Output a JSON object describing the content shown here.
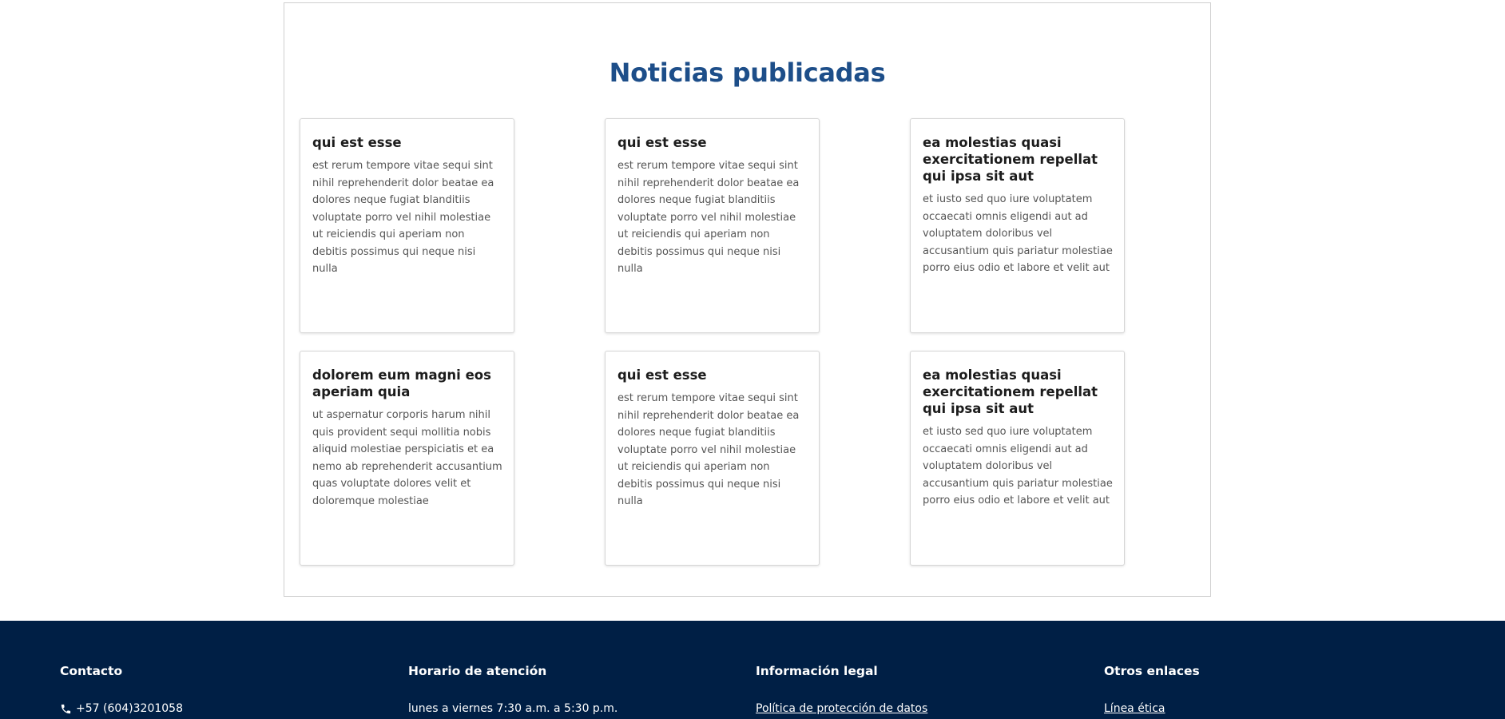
{
  "news": {
    "title": "Noticias publicadas",
    "cards": [
      {
        "title": "qui est esse",
        "body": "est rerum tempore vitae sequi sint nihil reprehenderit dolor beatae ea dolores neque fugiat blanditiis voluptate porro vel nihil molestiae ut reiciendis qui aperiam non debitis possimus qui neque nisi nulla"
      },
      {
        "title": "qui est esse",
        "body": "est rerum tempore vitae sequi sint nihil reprehenderit dolor beatae ea dolores neque fugiat blanditiis voluptate porro vel nihil molestiae ut reiciendis qui aperiam non debitis possimus qui neque nisi nulla"
      },
      {
        "title": "ea molestias quasi exercitationem repellat qui ipsa sit aut",
        "body": "et iusto sed quo iure voluptatem occaecati omnis eligendi aut ad voluptatem doloribus vel accusantium quis pariatur molestiae porro eius odio et labore et velit aut"
      },
      {
        "title": "dolorem eum magni eos aperiam quia",
        "body": "ut aspernatur corporis harum nihil quis provident sequi mollitia nobis aliquid molestiae perspiciatis et ea nemo ab reprehenderit accusantium quas voluptate dolores velit et doloremque molestiae"
      },
      {
        "title": "qui est esse",
        "body": "est rerum tempore vitae sequi sint nihil reprehenderit dolor beatae ea dolores neque fugiat blanditiis voluptate porro vel nihil molestiae ut reiciendis qui aperiam non debitis possimus qui neque nisi nulla"
      },
      {
        "title": "ea molestias quasi exercitationem repellat qui ipsa sit aut",
        "body": "et iusto sed quo iure voluptatem occaecati omnis eligendi aut ad voluptatem doloribus vel accusantium quis pariatur molestiae porro eius odio et labore et velit aut"
      }
    ]
  },
  "footer": {
    "contact": {
      "heading": "Contacto",
      "phone": "+57 (604)3201058",
      "icon": "phone-icon"
    },
    "schedule": {
      "heading": "Horario de atención",
      "hours": "lunes a viernes 7:30 a.m. a 5:30 p.m."
    },
    "legal": {
      "heading": "Información legal",
      "link": "Política de protección de datos"
    },
    "other": {
      "heading": "Otros enlaces",
      "link": "Línea ética"
    }
  },
  "colors": {
    "title": "#1d4e89",
    "footer_bg": "#001f45"
  }
}
